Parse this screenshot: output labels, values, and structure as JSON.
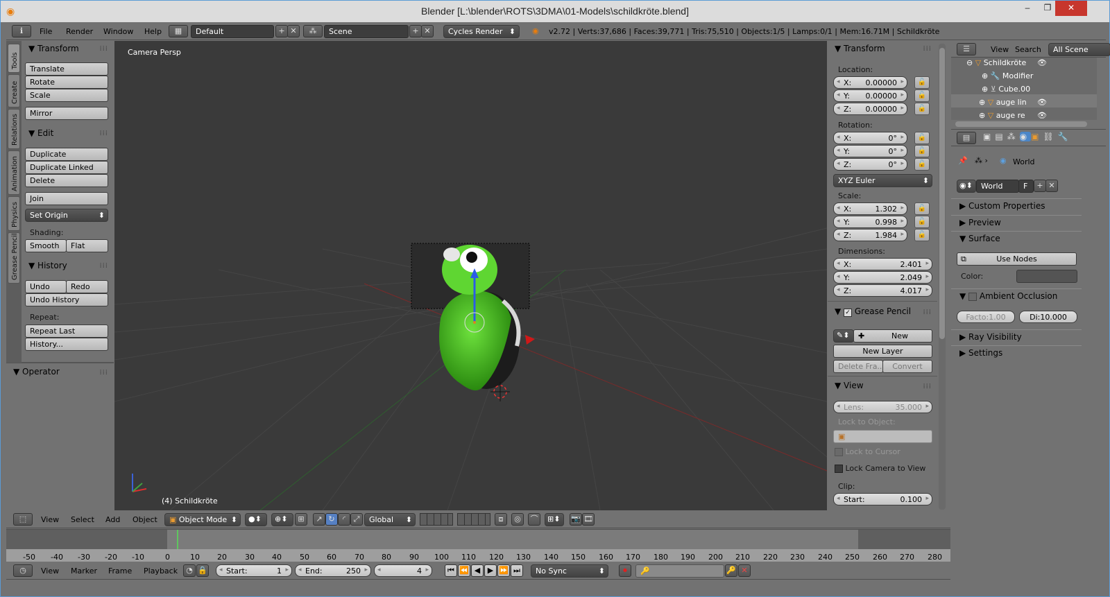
{
  "window": {
    "title": "Blender [L:\\blender\\ROTS\\3DMA\\01-Models\\schildkröte.blend]",
    "minimize": "–",
    "maximize": "❐",
    "close": "✕"
  },
  "infobar": {
    "menus": [
      "File",
      "Render",
      "Window",
      "Help"
    ],
    "layout": "Default",
    "scene": "Scene",
    "engine": "Cycles Render",
    "stats": "v2.72 | Verts:37,686 | Faces:39,771 | Tris:75,510 | Objects:1/5 | Lamps:0/1 | Mem:16.71M | Schildkröte"
  },
  "tool_tabs": [
    "Tools",
    "Create",
    "Relations",
    "Animation",
    "Physics",
    "Grease Pencil"
  ],
  "tools": {
    "transform_title": "Transform",
    "transform_buttons": [
      "Translate",
      "Rotate",
      "Scale"
    ],
    "mirror": "Mirror",
    "edit_title": "Edit",
    "edit_buttons": [
      "Duplicate",
      "Duplicate Linked",
      "Delete"
    ],
    "join": "Join",
    "set_origin": "Set Origin",
    "shading_label": "Shading:",
    "smooth": "Smooth",
    "flat": "Flat",
    "history_title": "History",
    "undo": "Undo",
    "redo": "Redo",
    "undo_history": "Undo History",
    "repeat_label": "Repeat:",
    "repeat_last": "Repeat Last",
    "history_more": "History...",
    "operator_title": "Operator"
  },
  "viewport": {
    "label": "Camera Persp",
    "object_label": "(4) Schildkröte"
  },
  "npanel": {
    "transform_title": "Transform",
    "location_label": "Location:",
    "location": [
      {
        "k": "X:",
        "v": "0.00000"
      },
      {
        "k": "Y:",
        "v": "0.00000"
      },
      {
        "k": "Z:",
        "v": "0.00000"
      }
    ],
    "rotation_label": "Rotation:",
    "rotation": [
      {
        "k": "X:",
        "v": "0°"
      },
      {
        "k": "Y:",
        "v": "0°"
      },
      {
        "k": "Z:",
        "v": "0°"
      }
    ],
    "rotation_mode": "XYZ Euler",
    "scale_label": "Scale:",
    "scale": [
      {
        "k": "X:",
        "v": "1.302"
      },
      {
        "k": "Y:",
        "v": "0.998"
      },
      {
        "k": "Z:",
        "v": "1.984"
      }
    ],
    "dimensions_label": "Dimensions:",
    "dimensions": [
      {
        "k": "X:",
        "v": "2.401"
      },
      {
        "k": "Y:",
        "v": "2.049"
      },
      {
        "k": "Z:",
        "v": "4.017"
      }
    ],
    "grease_title": "Grease Pencil",
    "gp_new": "New",
    "gp_new_layer": "New Layer",
    "gp_delete_frame": "Delete Fra...",
    "gp_convert": "Convert",
    "view_title": "View",
    "lens_label": "Lens:",
    "lens_value": "35.000",
    "lock_to_object": "Lock to Object:",
    "lock_to_cursor": "Lock to Cursor",
    "lock_camera": "Lock Camera to View",
    "clip_label": "Clip:",
    "clip_start_label": "Start:",
    "clip_start": "0.100"
  },
  "outliner": {
    "view": "View",
    "search": "Search",
    "scope": "All Scene",
    "items": [
      "Schildkröte",
      "Modifier",
      "Cube.00",
      "auge lin",
      "auge re"
    ]
  },
  "properties": {
    "context": "World",
    "world_name": "World",
    "fake": "F",
    "sections": [
      "Custom Properties",
      "Preview",
      "Surface"
    ],
    "use_nodes": "Use Nodes",
    "color_label": "Color:",
    "ao": "Ambient Occlusion",
    "ao_factor": "Facto:1.00",
    "ao_distance": "Di:10.000",
    "more_sections": [
      "Ray Visibility",
      "Settings"
    ]
  },
  "view3d_header": {
    "menus": [
      "View",
      "Select",
      "Add",
      "Object"
    ],
    "mode": "Object Mode",
    "orientation": "Global"
  },
  "timeline": {
    "ticks": [
      "-50",
      "-40",
      "-30",
      "-20",
      "-10",
      "0",
      "10",
      "20",
      "30",
      "40",
      "50",
      "60",
      "70",
      "80",
      "90",
      "100",
      "110",
      "120",
      "130",
      "140",
      "150",
      "160",
      "170",
      "180",
      "190",
      "200",
      "210",
      "220",
      "230",
      "240",
      "250",
      "260",
      "270",
      "280"
    ],
    "menus": [
      "View",
      "Marker",
      "Frame",
      "Playback"
    ],
    "start_label": "Start:",
    "start": "1",
    "end_label": "End:",
    "end": "250",
    "current": "4",
    "sync": "No Sync"
  }
}
